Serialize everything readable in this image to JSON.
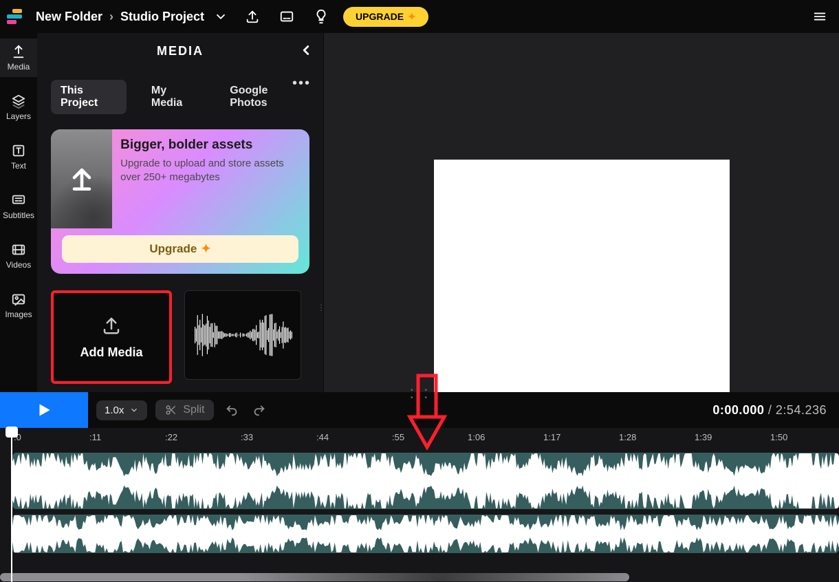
{
  "header": {
    "breadcrumb_parent": "New Folder",
    "breadcrumb_project": "Studio Project",
    "upgrade_label": "UPGRADE"
  },
  "siderail": [
    {
      "name": "media",
      "label": "Media"
    },
    {
      "name": "layers",
      "label": "Layers"
    },
    {
      "name": "text",
      "label": "Text"
    },
    {
      "name": "subtitles",
      "label": "Subtitles"
    },
    {
      "name": "videos",
      "label": "Videos"
    },
    {
      "name": "images",
      "label": "Images"
    }
  ],
  "panel": {
    "title": "MEDIA",
    "tabs": [
      "This Project",
      "My Media",
      "Google Photos"
    ],
    "active_tab": 0,
    "promo": {
      "heading": "Bigger, bolder assets",
      "body": "Upgrade to upload and store assets over 250+ megabytes",
      "cta": "Upgrade"
    },
    "tiles": {
      "add_label": "Add Media"
    }
  },
  "playbar": {
    "speed_label": "1.0x",
    "split_label": "Split",
    "current_time": "0:00.000",
    "total_time": "2:54.236"
  },
  "ruler_ticks": [
    ":0",
    ":11",
    ":22",
    ":33",
    ":44",
    ":55",
    "1:06",
    "1:17",
    "1:28",
    "1:39",
    "1:50"
  ]
}
